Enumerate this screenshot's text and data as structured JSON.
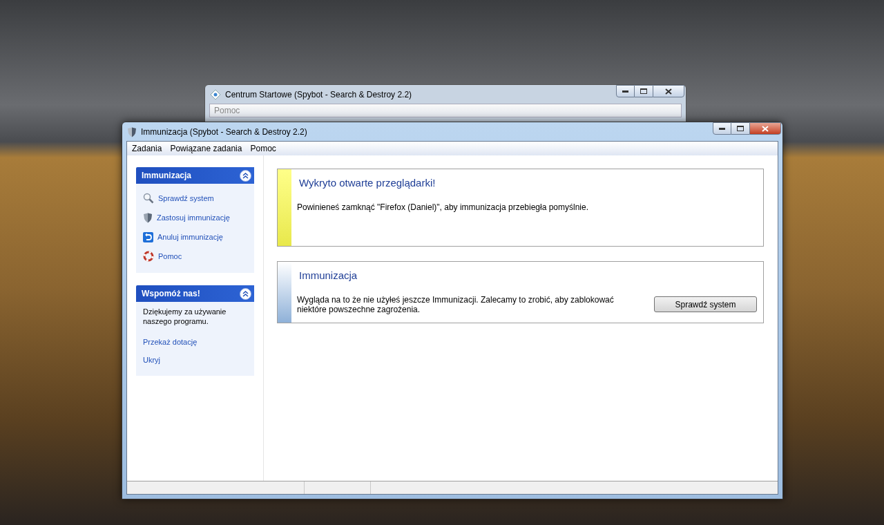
{
  "background_window": {
    "title": "Centrum Startowe (Spybot - Search & Destroy 2.2)",
    "active": false,
    "menu": [
      "Pomoc"
    ]
  },
  "window": {
    "title": "Immunizacja (Spybot - Search & Destroy 2.2)",
    "active": true,
    "menu": [
      "Zadania",
      "Powiązane zadania",
      "Pomoc"
    ]
  },
  "sidebar": {
    "panels": [
      {
        "title": "Immunizacja",
        "expanded": true,
        "items": [
          {
            "kind": "search",
            "label": "Sprawdź system"
          },
          {
            "kind": "shield",
            "label": "Zastosuj immunizację"
          },
          {
            "kind": "undo",
            "label": "Anuluj immunizację"
          },
          {
            "kind": "help",
            "label": "Pomoc"
          }
        ]
      },
      {
        "title": "Wspomóż nas!",
        "expanded": true,
        "items": [
          {
            "kind": "text",
            "label": "Dziękujemy za używanie naszego programu."
          },
          {
            "kind": "link",
            "label": "Przekaż dotację"
          },
          {
            "kind": "link",
            "label": "Ukryj"
          }
        ]
      }
    ]
  },
  "notices": [
    {
      "kind": "warning",
      "title": "Wykryto otwarte przeglądarki!",
      "message": "Powinieneś zamknąć \"Firefox (Daniel)\", aby immunizacja przebiegła pomyślnie."
    },
    {
      "kind": "info",
      "title": "Immunizacja",
      "message": "Wygląda na to że nie użyłeś jeszcze Immunizacji. Zalecamy to zrobić, aby zablokować niektóre powszechne zagrożenia.",
      "button": "Sprawdź system"
    }
  ]
}
